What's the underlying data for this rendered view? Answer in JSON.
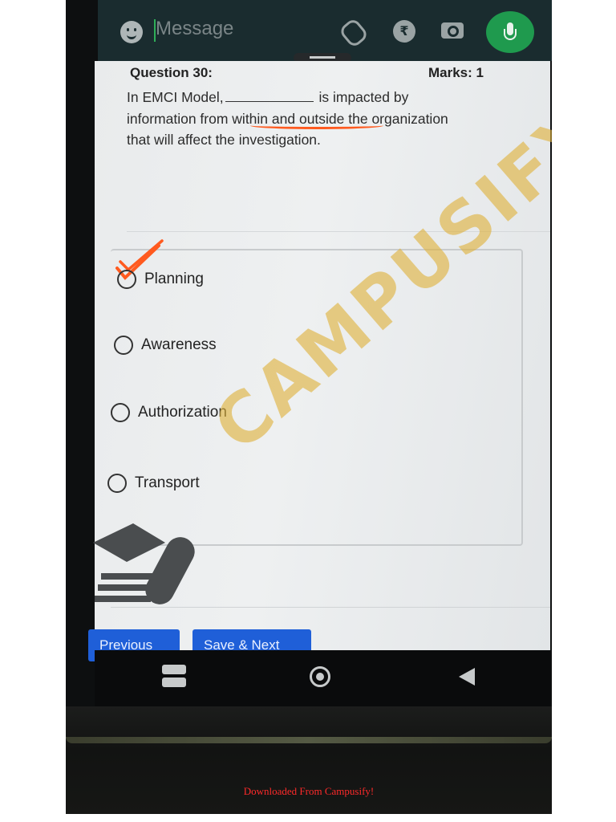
{
  "message_bar": {
    "placeholder": "Message",
    "icons": [
      "emoji-icon",
      "attach-icon",
      "rupee-icon",
      "camera-icon",
      "mic-icon"
    ],
    "mic_color": "#1f9a4e"
  },
  "question": {
    "title": "Question 30:",
    "marks": "Marks: 1",
    "text_part1": "In EMCI Model,",
    "text_part2": "is impacted by information from within and outside the organization that will affect the investigation."
  },
  "options": [
    {
      "label": "Planning",
      "checked_mark": true
    },
    {
      "label": "Awareness",
      "checked_mark": false
    },
    {
      "label": "Authorization",
      "checked_mark": false
    },
    {
      "label": "Transport",
      "checked_mark": false
    }
  ],
  "buttons": {
    "previous": "Previous",
    "save_next": "Save & Next"
  },
  "watermark": "CAMPUSIFY",
  "footer": "Downloaded From Campusify!",
  "colors": {
    "button_blue": "#1f5fd8",
    "annotation_orange": "#ff5a1f",
    "watermark": "#dfb13b",
    "footer_red": "#ff2a2a"
  }
}
